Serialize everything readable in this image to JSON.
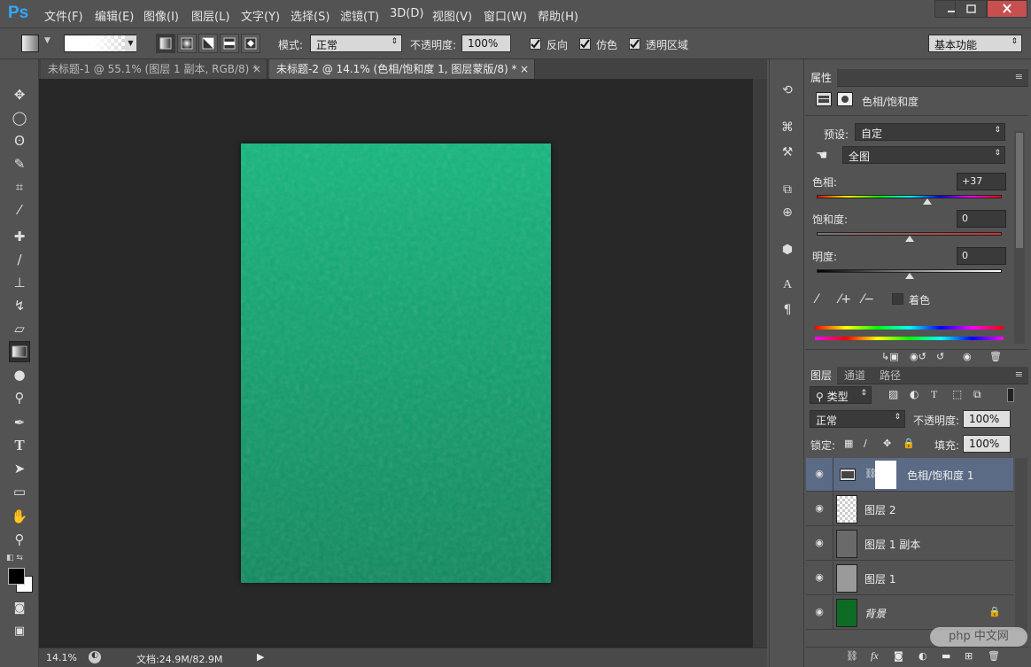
{
  "app": {
    "logo": "Ps"
  },
  "menu": [
    "文件(F)",
    "编辑(E)",
    "图像(I)",
    "图层(L)",
    "文字(Y)",
    "选择(S)",
    "滤镜(T)",
    "3D(D)",
    "视图(V)",
    "窗口(W)",
    "帮助(H)"
  ],
  "options": {
    "mode_label": "模式:",
    "mode_value": "正常",
    "opacity_label": "不透明度:",
    "opacity_value": "100%",
    "reverse": "反向",
    "dither": "仿色",
    "transparency": "透明区域",
    "workspace": "基本功能"
  },
  "tabs": [
    {
      "label": "未标题-1 @ 55.1% (图层 1 副本, RGB/8) *",
      "active": false
    },
    {
      "label": "未标题-2 @ 14.1% (色相/饱和度 1, 图层蒙版/8) *",
      "active": true
    }
  ],
  "status": {
    "zoom": "14.1%",
    "doc": "文档:24.9M/82.9M"
  },
  "properties": {
    "tab": "属性",
    "title": "色相/饱和度",
    "preset_label": "预设:",
    "preset_value": "自定",
    "channel_value": "全图",
    "hue_label": "色相:",
    "hue_value": "+37",
    "hue_level": 0.6,
    "sat_label": "饱和度:",
    "sat_value": "0",
    "sat_level": 0.5,
    "light_label": "明度:",
    "light_value": "0",
    "light_level": 0.5,
    "colorize": "着色"
  },
  "layers_panel": {
    "tabs": [
      "图层",
      "通道",
      "路径"
    ],
    "filter": "类型",
    "blend": "正常",
    "opacity_label": "不透明度:",
    "opacity_value": "100%",
    "lock_label": "锁定:",
    "fill_label": "填充:",
    "fill_value": "100%",
    "layers": [
      {
        "name": "色相/饱和度 1",
        "selected": true,
        "kind": "adjustment"
      },
      {
        "name": "图层 2",
        "selected": false,
        "kind": "transparent"
      },
      {
        "name": "图层 1 副本",
        "selected": false,
        "kind": "texture"
      },
      {
        "name": "图层 1",
        "selected": false,
        "kind": "texture-light"
      },
      {
        "name": "背景",
        "selected": false,
        "kind": "background"
      }
    ]
  },
  "watermark": "php 中文网",
  "colors": {
    "document": "#12a672",
    "background_swatch": "#0e6b23",
    "accent": "#31a8ff"
  }
}
